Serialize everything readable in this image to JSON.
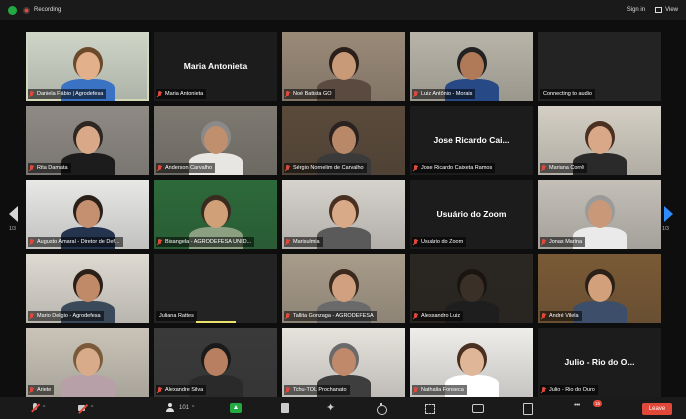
{
  "topbar": {
    "recording_label": "Recording",
    "signin_label": "Sign in",
    "view_label": "View"
  },
  "pages": {
    "left": "1/3",
    "right": "1/3"
  },
  "participants": [
    {
      "name": "Daniela Fábio | Agrodefesa",
      "type": "video",
      "bg": "#cfd6c8",
      "skin": "#e2b08a",
      "hair": "#6a4a2a",
      "shirt": "#3a72c4",
      "active": true
    },
    {
      "name": "Maria Antonieta",
      "type": "name",
      "center": "Maria Antonieta"
    },
    {
      "name": "Noé Batista GO",
      "type": "video",
      "bg": "#9a8a78",
      "skin": "#c99a78",
      "hair": "#2a1f1a",
      "shirt": "#5a4a40"
    },
    {
      "name": "Luiz Antônio - Morais",
      "type": "video",
      "bg": "#b8b4a8",
      "skin": "#b07a58",
      "hair": "#222222",
      "shirt": "#274a86"
    },
    {
      "name": "Connecting to audio",
      "type": "blank",
      "nomic": true
    },
    {
      "name": "Rita Damata",
      "type": "video",
      "bg": "#8f8a84",
      "skin": "#d8a888",
      "hair": "#2e2620",
      "shirt": "#1c1c1c"
    },
    {
      "name": "Anderson Carvalho",
      "type": "video",
      "bg": "#7e7a72",
      "skin": "#c0906e",
      "hair": "#8a8a8a",
      "shirt": "#e8e6e2"
    },
    {
      "name": "Sérgio Nornelim de Carvalho",
      "type": "video",
      "bg": "#5a4a3a",
      "skin": "#b88868",
      "hair": "#2a2220",
      "shirt": "#3a3a3a"
    },
    {
      "name": "Jose Ricardo Caixeta Ramos",
      "type": "name",
      "center": "Jose Ricardo Cai..."
    },
    {
      "name": "Mariana Corrê",
      "type": "video",
      "bg": "#d4cfc4",
      "skin": "#d8a888",
      "hair": "#4a3020",
      "shirt": "#2a2a2a"
    },
    {
      "name": "Augusto Amaral - Diretor de Def...",
      "type": "video",
      "bg": "#e8e8e6",
      "skin": "#c49070",
      "hair": "#2a2018",
      "shirt": "#24344e"
    },
    {
      "name": "Bisangela - AGRODEFESA UNID...",
      "type": "video",
      "bg": "#2c6a3a",
      "skin": "#d0a078",
      "hair": "#3a2a20",
      "shirt": "#8aa080"
    },
    {
      "name": "Marisulmia",
      "type": "video",
      "bg": "#d6d2cc",
      "skin": "#d8aa88",
      "hair": "#4a3020",
      "shirt": "#5a5a5a"
    },
    {
      "name": "Usuário do Zoom",
      "type": "name",
      "center": "Usuário do Zoom"
    },
    {
      "name": "Jonas Marina",
      "type": "video",
      "bg": "#c4c0b8",
      "skin": "#c89878",
      "hair": "#9a9a9a",
      "shirt": "#eaeaea"
    },
    {
      "name": "Mario Delgio - Agrodefesa",
      "type": "video",
      "bg": "#dedad2",
      "skin": "#c08a68",
      "hair": "#2a2018",
      "shirt": "#3a4a5a"
    },
    {
      "name": "Juliana Rattes",
      "type": "blank",
      "nomic": true,
      "underline": true
    },
    {
      "name": "Tallita Gonzaga - AGRODEFESA",
      "type": "video",
      "bg": "#a89c8a",
      "skin": "#d0a080",
      "hair": "#3a2a1e",
      "shirt": "#6a6a6a"
    },
    {
      "name": "Alessandro Luiz",
      "type": "video",
      "bg": "#2a2622",
      "skin": "#3a3028",
      "hair": "#1a1410",
      "shirt": "#1e1e1e"
    },
    {
      "name": "André Vilela",
      "type": "video",
      "bg": "#7a5a36",
      "skin": "#d2a07a",
      "hair": "#2a2018",
      "shirt": "#3c4e6a"
    },
    {
      "name": "Ariete",
      "type": "video",
      "bg": "#cac4b8",
      "skin": "#d8ac8a",
      "hair": "#7a5a3a",
      "shirt": "#b8a0a8"
    },
    {
      "name": "Alexandre Silva",
      "type": "video",
      "bg": "#3a3a3a",
      "skin": "#b88060",
      "hair": "#1a1a1a",
      "shirt": "#2a2a2a"
    },
    {
      "name": "Tchu-TOL Prochanato",
      "type": "video",
      "bg": "#e6e2dc",
      "skin": "#c08a6a",
      "hair": "#6a6a6a",
      "shirt": "#3e3e3e"
    },
    {
      "name": "Nathalia Fonseca",
      "type": "video",
      "bg": "#efedea",
      "skin": "#e0b698",
      "hair": "#4a3020",
      "shirt": "#ffffff"
    },
    {
      "name": "Julio - Rio do Ouro",
      "type": "name",
      "center": "Julio - Rio do O..."
    }
  ],
  "toolbar": {
    "participants_count": "101",
    "chat_badge": "15",
    "leave_label": "Leave"
  },
  "colors": {
    "accent": "#2d8cff",
    "mute": "#e0493a",
    "share": "#23a942",
    "active_border": "#e9e36b"
  }
}
